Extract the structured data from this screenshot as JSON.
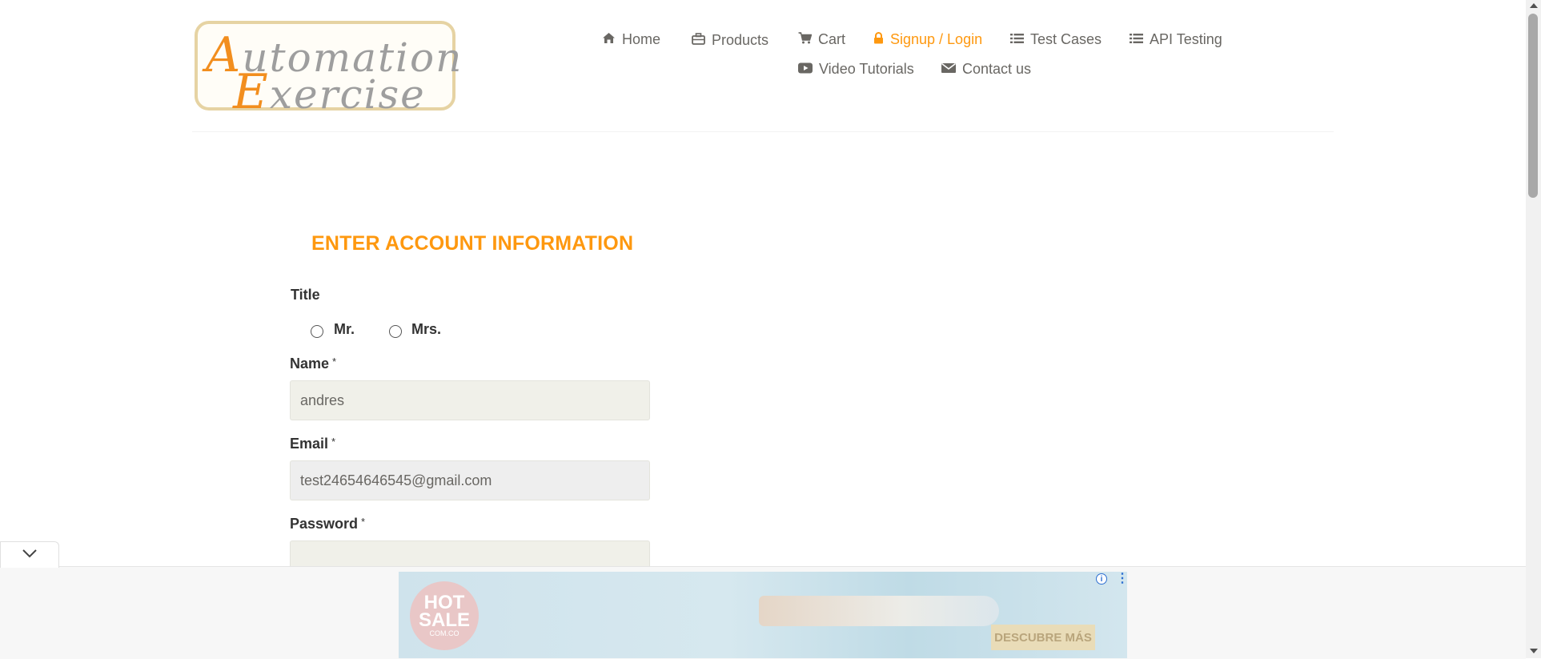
{
  "logo": {
    "line1_cap": "A",
    "line1_rest": "utomation",
    "line2_cap": "E",
    "line2_rest": "xercise"
  },
  "nav": {
    "items": [
      {
        "label": "Home",
        "icon": "home-icon"
      },
      {
        "label": "Products",
        "icon": "briefcase-icon"
      },
      {
        "label": "Cart",
        "icon": "cart-icon"
      },
      {
        "label": "Signup / Login",
        "icon": "lock-icon",
        "active": true
      },
      {
        "label": "Test Cases",
        "icon": "list-icon"
      },
      {
        "label": "API Testing",
        "icon": "list-icon"
      },
      {
        "label": "Video Tutorials",
        "icon": "youtube-play-icon"
      },
      {
        "label": "Contact us",
        "icon": "envelope-icon"
      }
    ],
    "active_color": "#fe980f"
  },
  "form": {
    "title": "ENTER ACCOUNT INFORMATION",
    "title_label": "Title",
    "title_options": [
      "Mr.",
      "Mrs."
    ],
    "name_label": "Name",
    "name_value": "andres",
    "email_label": "Email",
    "email_value": "test24654646545@gmail.com",
    "password_label": "Password",
    "password_value": "",
    "required_mark": "*"
  },
  "ad": {
    "logo_line1": "HOT",
    "logo_line2": "SALE",
    "logo_sub": "COM.CO",
    "cta": "DESCUBRE MÁS",
    "info_symbol": "i",
    "menu_symbol": "⋮"
  },
  "colors": {
    "accent": "#fe980f",
    "text": "#696763",
    "field_bg": "#f0f0e9"
  }
}
